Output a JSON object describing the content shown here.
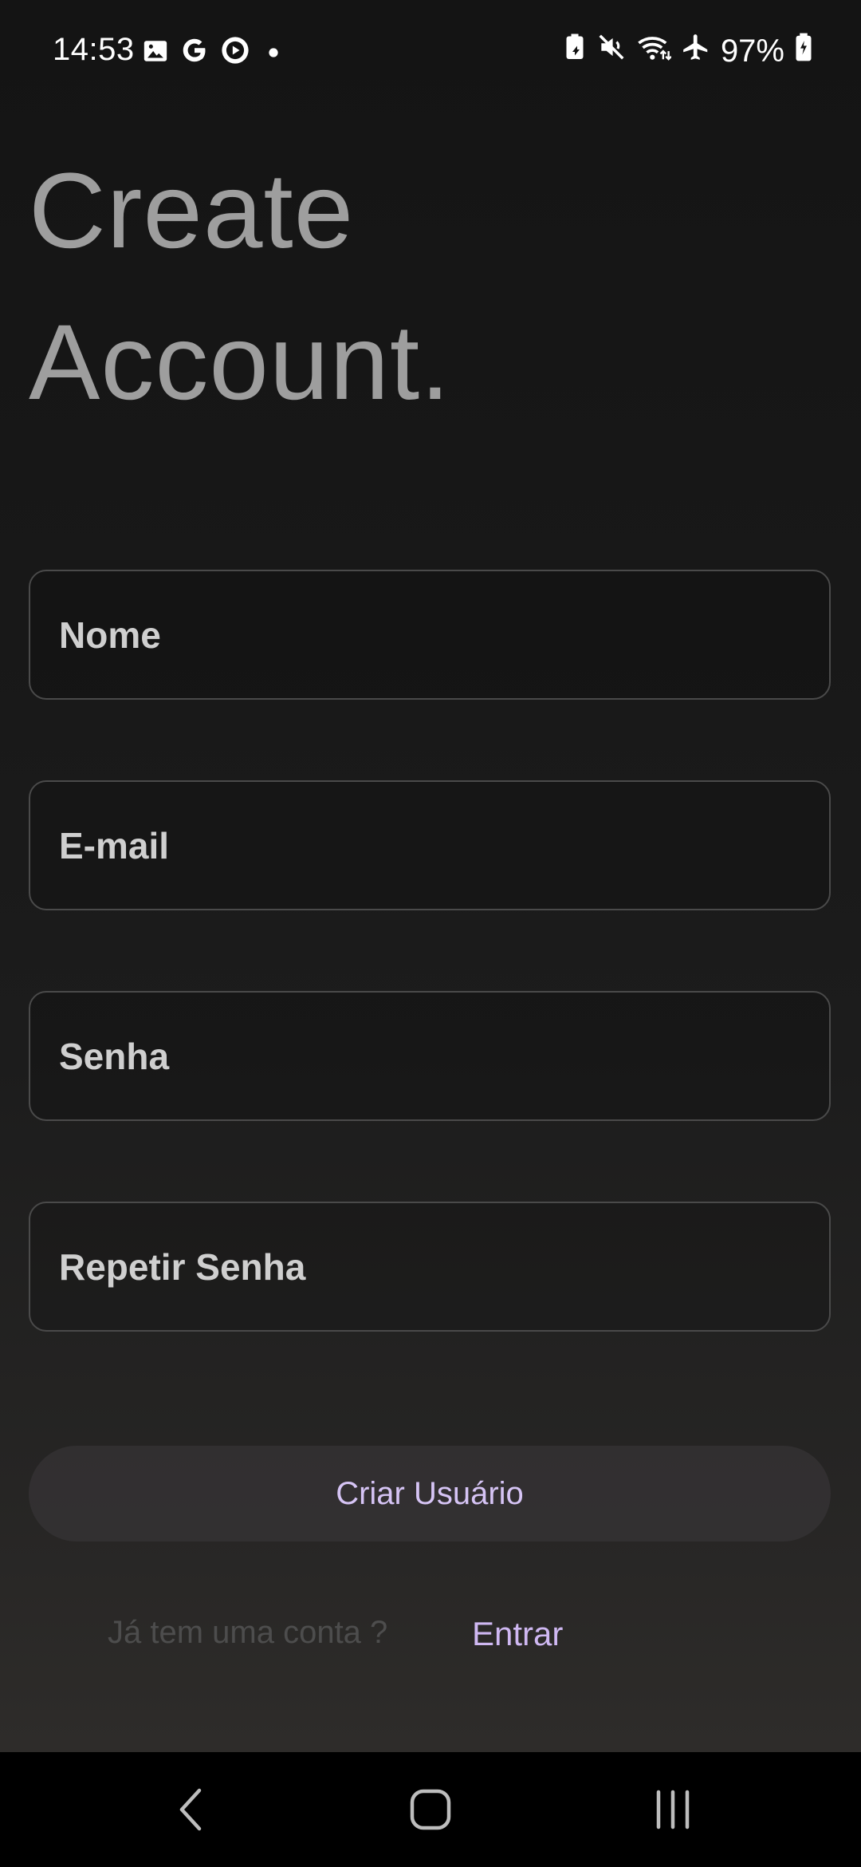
{
  "status_bar": {
    "time": "14:53",
    "left_icons": [
      "image-icon",
      "google-icon",
      "play-icon",
      "dot-icon"
    ],
    "right_icons": [
      "battery-saver-icon",
      "mute-icon",
      "wifi-icon",
      "airplane-icon"
    ],
    "battery": "97%"
  },
  "title": {
    "line1": "Create",
    "line2": "Account."
  },
  "form": {
    "name_placeholder": "Nome",
    "email_placeholder": "E-mail",
    "password_placeholder": "Senha",
    "repeat_password_placeholder": "Repetir Senha",
    "submit_label": "Criar Usuário"
  },
  "login": {
    "question": "Já tem uma conta ?",
    "link": "Entrar"
  },
  "colors": {
    "accent": "#cfb8f2",
    "title": "#9e9e9e"
  }
}
